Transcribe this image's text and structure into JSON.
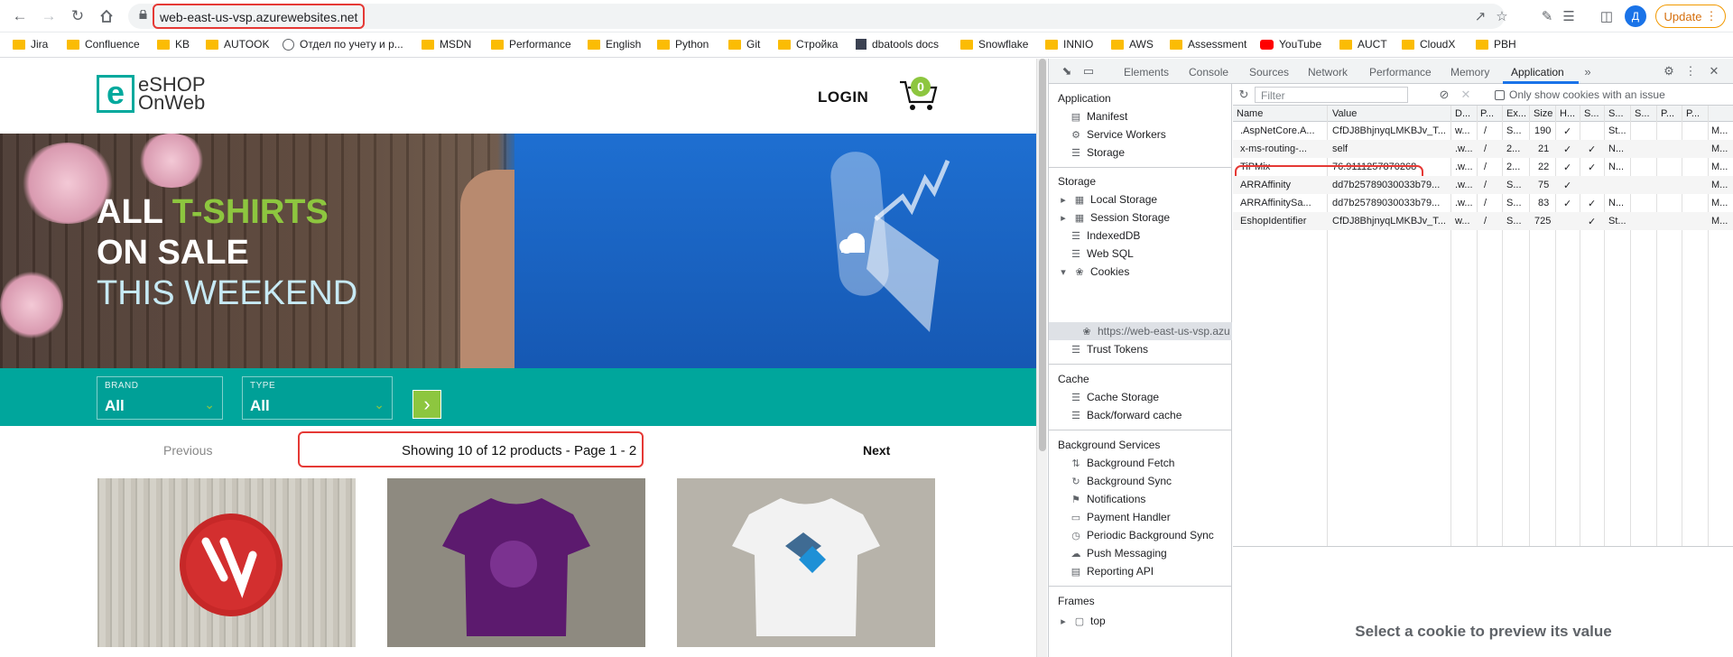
{
  "browser": {
    "url": "web-east-us-vsp.azurewebsites.net",
    "avatar_letter": "Д",
    "update_label": "Update"
  },
  "bookmarks": [
    {
      "label": "Jira",
      "icon": "folder-icon"
    },
    {
      "label": "Confluence",
      "icon": "folder-icon"
    },
    {
      "label": "KB",
      "icon": "folder-icon"
    },
    {
      "label": "AUTOOK",
      "icon": "folder-icon"
    },
    {
      "label": "Отдел по учету и р...",
      "icon": "globe-icon"
    },
    {
      "label": "MSDN",
      "icon": "folder-icon"
    },
    {
      "label": "Performance",
      "icon": "folder-icon"
    },
    {
      "label": "English",
      "icon": "folder-icon"
    },
    {
      "label": "Python",
      "icon": "folder-icon"
    },
    {
      "label": "Git",
      "icon": "folder-icon"
    },
    {
      "label": "Стройка",
      "icon": "folder-icon"
    },
    {
      "label": "dbatools docs",
      "icon": "site-icon"
    },
    {
      "label": "Snowflake",
      "icon": "folder-icon"
    },
    {
      "label": "INNIO",
      "icon": "folder-icon"
    },
    {
      "label": "AWS",
      "icon": "folder-icon"
    },
    {
      "label": "Assessment",
      "icon": "folder-icon"
    },
    {
      "label": "YouTube",
      "icon": "youtube-icon"
    },
    {
      "label": "AUCT",
      "icon": "folder-icon"
    },
    {
      "label": "CloudX",
      "icon": "folder-icon"
    },
    {
      "label": "PBH",
      "icon": "folder-icon"
    }
  ],
  "site": {
    "logo_mark": "e",
    "logo_line1": "eSHOP",
    "logo_line2": "OnWeb",
    "login": "LOGIN",
    "cart_count": "0",
    "hero_line1_a": "ALL ",
    "hero_line1_b": "T-SHIRTS",
    "hero_line2": "ON SALE",
    "hero_line3": "THIS WEEKEND",
    "brand_label": "BRAND",
    "brand_value": "All",
    "type_label": "TYPE",
    "type_value": "All",
    "previous": "Previous",
    "showing": "Showing 10 of 12 products - Page 1 - 2",
    "next": "Next"
  },
  "devtools": {
    "tabs": [
      "Elements",
      "Console",
      "Sources",
      "Network",
      "Performance",
      "Memory",
      "Application"
    ],
    "active_tab": "Application",
    "sidebar": {
      "application_header": "Application",
      "application_items": [
        "Manifest",
        "Service Workers",
        "Storage"
      ],
      "storage_header": "Storage",
      "storage_items": [
        "Local Storage",
        "Session Storage",
        "IndexedDB",
        "Web SQL",
        "Cookies"
      ],
      "cookie_origin": "https://web-east-us-vsp.azu",
      "trust_tokens": "Trust Tokens",
      "cache_header": "Cache",
      "cache_items": [
        "Cache Storage",
        "Back/forward cache"
      ],
      "bg_header": "Background Services",
      "bg_items": [
        "Background Fetch",
        "Background Sync",
        "Notifications",
        "Payment Handler",
        "Periodic Background Sync",
        "Push Messaging",
        "Reporting API"
      ],
      "frames_header": "Frames",
      "frames_item": "top"
    },
    "filter_placeholder": "Filter",
    "only_issue_label": "Only show cookies with an issue",
    "columns": [
      "Name",
      "Value",
      "D...",
      "P...",
      "Ex...",
      "Size",
      "H...",
      "S...",
      "S...",
      "S...",
      "P...",
      "P..."
    ],
    "cookies": [
      {
        "name": ".AspNetCore.A...",
        "value": "CfDJ8BhjnyqLMKBJv_T...",
        "d": "w...",
        "p": "/",
        "ex": "S...",
        "size": "190",
        "h": "✓",
        "s": "",
        "ss": "St...",
        "m": "M..."
      },
      {
        "name": "x-ms-routing-...",
        "value": "self",
        "d": ".w...",
        "p": "/",
        "ex": "2...",
        "size": "21",
        "h": "✓",
        "s": "✓",
        "ss": "N...",
        "m": "M..."
      },
      {
        "name": "TiPMix",
        "value": "76.9111257870268",
        "d": ".w...",
        "p": "/",
        "ex": "2...",
        "size": "22",
        "h": "✓",
        "s": "✓",
        "ss": "N...",
        "m": "M..."
      },
      {
        "name": "ARRAffinity",
        "value": "dd7b25789030033b79...",
        "d": ".w...",
        "p": "/",
        "ex": "S...",
        "size": "75",
        "h": "✓",
        "s": "",
        "ss": "",
        "m": "M..."
      },
      {
        "name": "ARRAffinitySa...",
        "value": "dd7b25789030033b79...",
        "d": ".w...",
        "p": "/",
        "ex": "S...",
        "size": "83",
        "h": "✓",
        "s": "✓",
        "ss": "N...",
        "m": "M..."
      },
      {
        "name": "EshopIdentifier",
        "value": "CfDJ8BhjnyqLMKBJv_T...",
        "d": "w...",
        "p": "/",
        "ex": "S...",
        "size": "725",
        "h": "",
        "s": "✓",
        "ss": "St...",
        "m": "M..."
      }
    ],
    "preview_text": "Select a cookie to preview its value"
  }
}
